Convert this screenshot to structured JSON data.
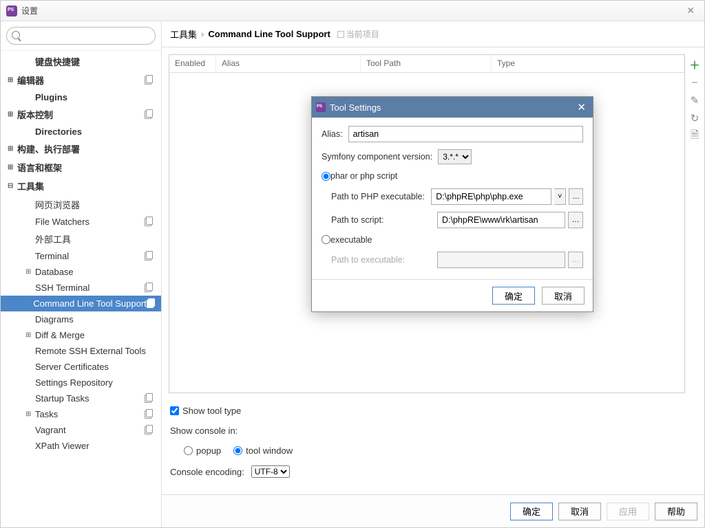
{
  "window": {
    "title": "设置"
  },
  "search": {
    "placeholder": ""
  },
  "tree": [
    {
      "label": "键盘快捷键",
      "bold": true,
      "indent": 1
    },
    {
      "label": "编辑器",
      "bold": true,
      "expander": "⊞",
      "copy": true
    },
    {
      "label": "Plugins",
      "bold": true,
      "indent": 1
    },
    {
      "label": "版本控制",
      "bold": true,
      "expander": "⊞",
      "copy": true
    },
    {
      "label": "Directories",
      "bold": true,
      "indent": 1
    },
    {
      "label": "构建、执行部署",
      "bold": true,
      "expander": "⊞"
    },
    {
      "label": "语言和框架",
      "bold": true,
      "expander": "⊞"
    },
    {
      "label": "工具集",
      "bold": true,
      "expander": "⊟"
    },
    {
      "label": "网页浏览器",
      "indent": 2
    },
    {
      "label": "File Watchers",
      "indent": 2,
      "copy": true
    },
    {
      "label": "外部工具",
      "indent": 2
    },
    {
      "label": "Terminal",
      "indent": 2,
      "copy": true
    },
    {
      "label": "Database",
      "indent": 2,
      "expander": "⊞"
    },
    {
      "label": "SSH Terminal",
      "indent": 2,
      "copy": true
    },
    {
      "label": "Command Line Tool Support",
      "indent": 2,
      "copy": true,
      "selected": true
    },
    {
      "label": "Diagrams",
      "indent": 2
    },
    {
      "label": "Diff & Merge",
      "indent": 2,
      "expander": "⊞"
    },
    {
      "label": "Remote SSH External Tools",
      "indent": 2
    },
    {
      "label": "Server Certificates",
      "indent": 2
    },
    {
      "label": "Settings Repository",
      "indent": 2
    },
    {
      "label": "Startup Tasks",
      "indent": 2,
      "copy": true
    },
    {
      "label": "Tasks",
      "indent": 2,
      "expander": "⊞",
      "copy": true
    },
    {
      "label": "Vagrant",
      "indent": 2,
      "copy": true
    },
    {
      "label": "XPath Viewer",
      "indent": 2
    }
  ],
  "breadcrumb": {
    "root": "工具集",
    "current": "Command Line Tool Support",
    "tag": "当前项目"
  },
  "table": {
    "headers": {
      "enabled": "Enabled",
      "alias": "Alias",
      "toolpath": "Tool Path",
      "type": "Type"
    }
  },
  "options": {
    "show_tool_type": "Show tool type",
    "show_console_in": "Show console in:",
    "popup": "popup",
    "tool_window": "tool window",
    "console_encoding_label": "Console encoding:",
    "console_encoding_value": "UTF-8"
  },
  "footer": {
    "ok": "确定",
    "cancel": "取消",
    "apply": "应用",
    "help": "帮助"
  },
  "dialog": {
    "title": "Tool Settings",
    "alias_label": "Alias:",
    "alias_value": "artisan",
    "symfony_label": "Symfony component version:",
    "symfony_value": "3.*.*",
    "radio_phar": "phar or php script",
    "php_exec_label": "Path to PHP executable:",
    "php_exec_value": "D:\\phpRE\\php\\php.exe",
    "script_label": "Path to script:",
    "script_value": "D:\\phpRE\\www\\rk\\artisan",
    "radio_exec": "executable",
    "exec_path_label": "Path to executable:",
    "exec_path_value": "",
    "ok": "确定",
    "cancel": "取消"
  }
}
